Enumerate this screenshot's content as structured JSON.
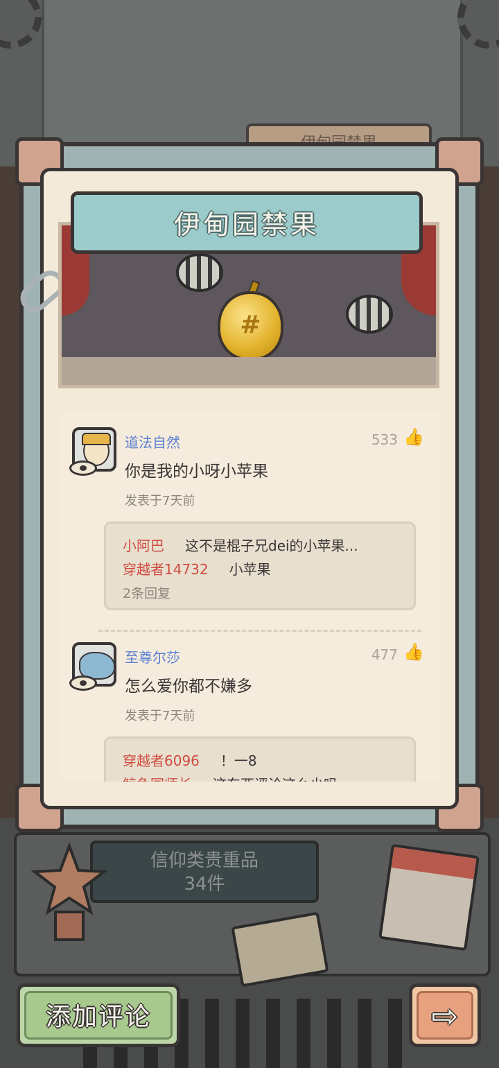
{
  "background": {
    "tab_label": "伊甸园禁果",
    "category": {
      "name": "信仰类贵重品",
      "count": "34件"
    }
  },
  "item": {
    "title": "伊甸园禁果"
  },
  "comments": [
    {
      "username": "道法自然",
      "likes": "533",
      "text": "你是我的小呀小苹果",
      "time": "发表于7天前",
      "replies": [
        {
          "user": "小阿巴",
          "text": "这不是棍子兄dei的小苹果..."
        },
        {
          "user": "穿越者14732",
          "text": "小苹果"
        }
      ],
      "reply_count": "2条回复"
    },
    {
      "username": "至尊尔莎",
      "likes": "477",
      "text": "怎么爱你都不嫌多",
      "time": "发表于7天前",
      "replies": [
        {
          "user": "穿越者6096",
          "text": "！一8"
        },
        {
          "user": "鲸鱼园师长",
          "text": "这东西评论这么少吗"
        }
      ]
    }
  ],
  "buttons": {
    "add_comment": "添加评论",
    "next": "⇨"
  },
  "icons": {
    "like": "thumbs-up-icon"
  }
}
